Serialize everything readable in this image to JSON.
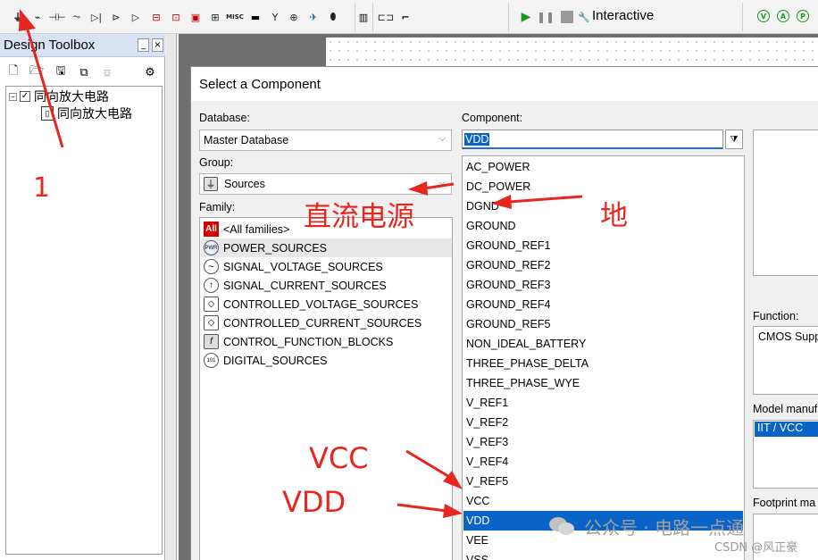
{
  "toolbar": {
    "sim_mode_label": "Interactive",
    "place_icons": [
      "ground-place-icon",
      "resistor-place-icon",
      "capacitor-place-icon",
      "inductor-place-icon",
      "diode-place-icon",
      "transistor-place-icon",
      "analog-place-icon",
      "ttl-place-icon",
      "cmos-place-icon",
      "misc-digital-place-icon",
      "mixed-place-icon",
      "indicator-place-icon",
      "misc-place-icon",
      "advanced-peripherals-icon",
      "rf-place-icon",
      "electromechanical-place-icon",
      "ni-place-icon",
      "connector-place-icon"
    ],
    "misc_text": "MISC",
    "accent_play": "#1a9a1a"
  },
  "design_toolbox": {
    "title": "Design Toolbox",
    "minimize_glyph": "_",
    "close_glyph": "×",
    "tree": [
      {
        "label": "同向放大电路",
        "level": 0
      },
      {
        "label": "同向放大电路",
        "level": 1
      }
    ]
  },
  "dialog": {
    "title": "Select a Component",
    "database_label": "Database:",
    "database_value": "Master Database",
    "group_label": "Group:",
    "group_value": "Sources",
    "family_label": "Family:",
    "families": [
      {
        "label": "<All families>",
        "icon": "all-families-icon",
        "icon_text": "All"
      },
      {
        "label": "POWER_SOURCES",
        "icon": "power-sources-icon",
        "icon_text": "PWR",
        "selected": true
      },
      {
        "label": "SIGNAL_VOLTAGE_SOURCES",
        "icon": "signal-voltage-icon",
        "icon_text": "~"
      },
      {
        "label": "SIGNAL_CURRENT_SOURCES",
        "icon": "signal-current-icon",
        "icon_text": "↑"
      },
      {
        "label": "CONTROLLED_VOLTAGE_SOURCES",
        "icon": "controlled-voltage-icon",
        "icon_text": "◇"
      },
      {
        "label": "CONTROLLED_CURRENT_SOURCES",
        "icon": "controlled-current-icon",
        "icon_text": "◇"
      },
      {
        "label": "CONTROL_FUNCTION_BLOCKS",
        "icon": "function-block-icon",
        "icon_text": "f"
      },
      {
        "label": "DIGITAL_SOURCES",
        "icon": "digital-sources-icon",
        "icon_text": "101"
      }
    ],
    "component_label": "Component:",
    "component_value": "VDD",
    "components": [
      "AC_POWER",
      "DC_POWER",
      "DGND",
      "GROUND",
      "GROUND_REF1",
      "GROUND_REF2",
      "GROUND_REF3",
      "GROUND_REF4",
      "GROUND_REF5",
      "NON_IDEAL_BATTERY",
      "THREE_PHASE_DELTA",
      "THREE_PHASE_WYE",
      "V_REF1",
      "V_REF2",
      "V_REF3",
      "V_REF4",
      "V_REF5",
      "VCC",
      "VDD",
      "VEE",
      "VSS"
    ],
    "selected_component": "VDD",
    "function_label": "Function:",
    "function_value": "CMOS Supp",
    "model_label": "Model manuf",
    "model_value": "IIT / VCC",
    "footprint_label": "Footprint ma",
    "selection_color": "#0a64c8"
  },
  "annotations": {
    "number_1": "1",
    "dc_power": "直流电源",
    "ground": "地",
    "vcc": "VCC",
    "vdd": "VDD",
    "color": "#e8251f"
  },
  "watermark": {
    "brand": "公众号 · 电路一点通",
    "csdn": "CSDN @风正豪"
  }
}
